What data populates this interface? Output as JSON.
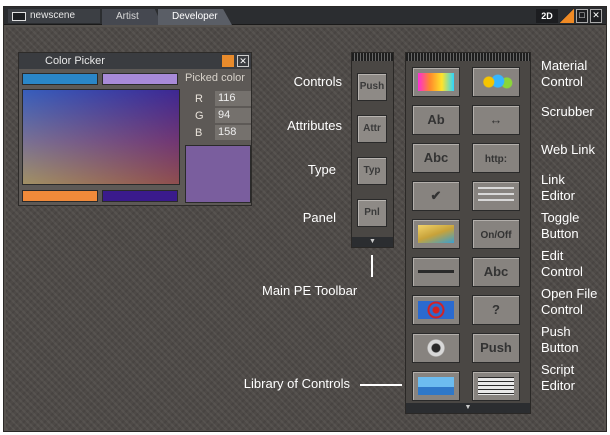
{
  "window": {
    "scene_tab": "newscene",
    "tabs": [
      "Artist",
      "Developer"
    ],
    "mode_label": "2D"
  },
  "color_picker": {
    "title": "Color Picker",
    "picked_label": "Picked color",
    "r_label": "R",
    "r_value": "116",
    "g_label": "G",
    "g_value": "94",
    "b_label": "B",
    "b_value": "158",
    "colors": {
      "top_left_bar": "#2a86c8",
      "top_right_bar": "#a88ad8",
      "bottom_left_bar": "#f08a3a",
      "bottom_right_bar": "#3a1a8c",
      "picked": "#7a5e9e"
    }
  },
  "main_toolbar": {
    "caption": "Main PE Toolbar",
    "buttons": [
      "Push",
      "Attr",
      "Typ",
      "Pnl"
    ],
    "labels": [
      "Controls",
      "Attributes",
      "Type",
      "Panel"
    ]
  },
  "library": {
    "caption": "Library of Controls",
    "buttons": [
      {
        "icon": "material-gradient-icon",
        "text": ""
      },
      {
        "icon": "spheres-icon",
        "text": ""
      },
      {
        "icon": "dropdown-icon",
        "text": "Ab"
      },
      {
        "icon": "scrubber-arrows-icon",
        "text": "↔"
      },
      {
        "icon": "abc-label-icon",
        "text": "Abc"
      },
      {
        "icon": "weblink-icon",
        "text": "http:"
      },
      {
        "icon": "checkbox-icon",
        "text": "✔"
      },
      {
        "icon": "link-editor-icon",
        "text": ""
      },
      {
        "icon": "layers-icon",
        "text": ""
      },
      {
        "icon": "toggle-icon",
        "text": "On/Off"
      },
      {
        "icon": "slider-icon",
        "text": ""
      },
      {
        "icon": "edit-control-icon",
        "text": "Abc"
      },
      {
        "icon": "target-icon",
        "text": ""
      },
      {
        "icon": "help-icon",
        "text": "?"
      },
      {
        "icon": "radio-icon",
        "text": ""
      },
      {
        "icon": "push-icon",
        "text": "Push"
      },
      {
        "icon": "landscape-icon",
        "text": ""
      },
      {
        "icon": "script-editor-icon",
        "text": ""
      }
    ],
    "labels": [
      "Material\nControl",
      "Scrubber",
      "Web Link",
      "Link\nEditor",
      "Toggle\nButton",
      "Edit\nControl",
      "Open File\nControl",
      "Push\nButton",
      "Script\nEditor"
    ]
  }
}
